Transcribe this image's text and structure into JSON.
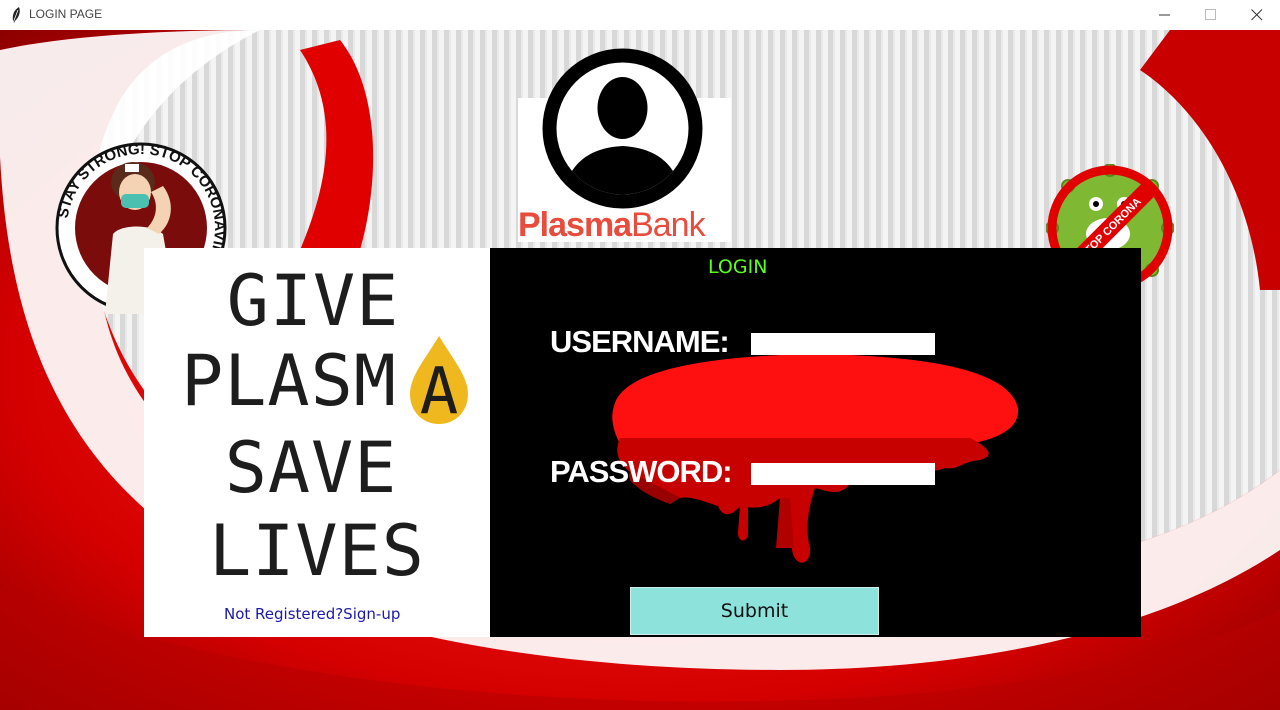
{
  "window": {
    "title": "LOGIN PAGE",
    "controls": [
      "minimize",
      "maximize",
      "close"
    ]
  },
  "logo": {
    "text_bold": "Plasma",
    "text_regular": "Bank",
    "icon": "user-silhouette-icon"
  },
  "poster": {
    "lines": [
      "GIVE",
      "PLASM",
      "SAVE",
      "LIVES"
    ],
    "drop_letter": "A",
    "signup_link": "Not Registered?Sign-up"
  },
  "badges": {
    "left_text": "STAY STRONG! STOP CORONAVIRUS!",
    "right_text": "STOP CORONA"
  },
  "login": {
    "title": "LOGIN",
    "username_label": "USERNAME:",
    "password_label": "PASSWORD:",
    "username_value": "",
    "password_value": "",
    "submit_label": "Submit"
  },
  "colors": {
    "background_red": "#d10000",
    "panel": "#000000",
    "login_title": "#5cff1a",
    "submit_bg": "#8de3db",
    "link": "#1a1aa8",
    "logo_text": "#e84c3d",
    "drop": "#f0b81f"
  }
}
